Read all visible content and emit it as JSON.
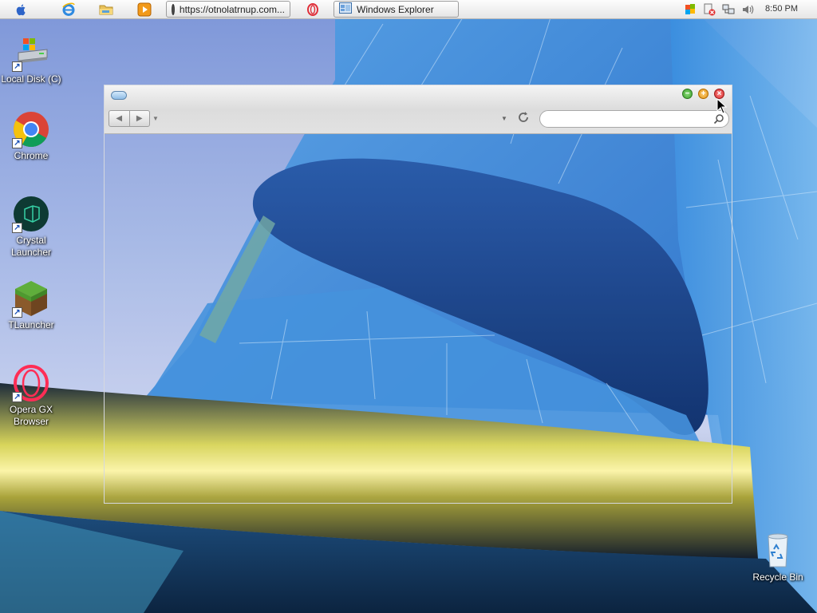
{
  "taskbar": {
    "start_icon": "apple-icon",
    "quick_launch": [
      {
        "name": "internet-explorer-icon"
      },
      {
        "name": "folder-icon"
      },
      {
        "name": "media-player-icon"
      }
    ],
    "browser_task": {
      "icon": "browser-tab-icon",
      "label": "https://otnolatrnup.com..."
    },
    "opera_icon": "opera-icon",
    "explorer_task": {
      "icon": "windows-explorer-icon",
      "label": "Windows Explorer"
    },
    "tray_icons": [
      "flag-icon",
      "network-blocked-icon",
      "network-icon",
      "volume-icon"
    ],
    "clock": "8:50 PM"
  },
  "desktop": {
    "icons": [
      {
        "id": "local-disk",
        "label": "Local Disk (C)"
      },
      {
        "id": "chrome",
        "label": "Chrome"
      },
      {
        "id": "crystal",
        "label": "Crystal Launcher"
      },
      {
        "id": "tlauncher",
        "label": "TLauncher"
      },
      {
        "id": "opera-gx",
        "label": "Opera GX Browser"
      }
    ],
    "recycle_bin": {
      "label": "Recycle Bin"
    }
  },
  "explorer": {
    "search": {
      "value": "",
      "placeholder": ""
    },
    "buttons": {
      "minimize_color": "#4caf3f",
      "maximize_color": "#f0a020",
      "close_color": "#e03b3b"
    }
  }
}
